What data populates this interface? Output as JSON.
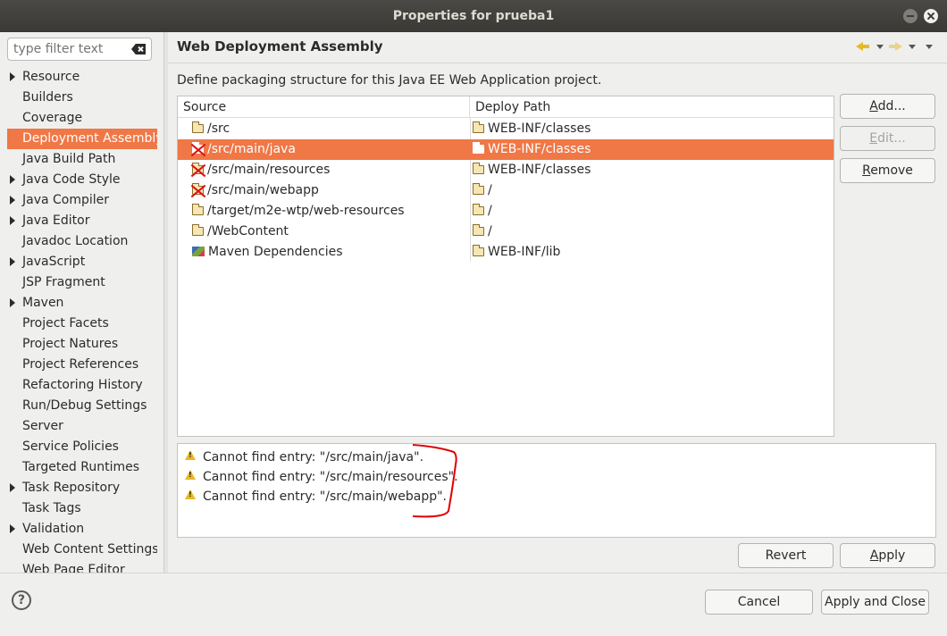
{
  "window": {
    "title": "Properties for prueba1"
  },
  "filter": {
    "placeholder": "type filter text"
  },
  "nav": {
    "items": [
      {
        "label": "Resource",
        "expandable": true
      },
      {
        "label": "Builders",
        "expandable": false
      },
      {
        "label": "Coverage",
        "expandable": false
      },
      {
        "label": "Deployment Assembly",
        "expandable": false,
        "selected": true
      },
      {
        "label": "Java Build Path",
        "expandable": false
      },
      {
        "label": "Java Code Style",
        "expandable": true
      },
      {
        "label": "Java Compiler",
        "expandable": true
      },
      {
        "label": "Java Editor",
        "expandable": true
      },
      {
        "label": "Javadoc Location",
        "expandable": false
      },
      {
        "label": "JavaScript",
        "expandable": true
      },
      {
        "label": "JSP Fragment",
        "expandable": false
      },
      {
        "label": "Maven",
        "expandable": true
      },
      {
        "label": "Project Facets",
        "expandable": false
      },
      {
        "label": "Project Natures",
        "expandable": false
      },
      {
        "label": "Project References",
        "expandable": false
      },
      {
        "label": "Refactoring History",
        "expandable": false
      },
      {
        "label": "Run/Debug Settings",
        "expandable": false
      },
      {
        "label": "Server",
        "expandable": false
      },
      {
        "label": "Service Policies",
        "expandable": false
      },
      {
        "label": "Targeted Runtimes",
        "expandable": false
      },
      {
        "label": "Task Repository",
        "expandable": true
      },
      {
        "label": "Task Tags",
        "expandable": false
      },
      {
        "label": "Validation",
        "expandable": true
      },
      {
        "label": "Web Content Settings",
        "expandable": false
      },
      {
        "label": "Web Page Editor",
        "expandable": false
      }
    ]
  },
  "page": {
    "title": "Web Deployment Assembly",
    "description": "Define packaging structure for this Java EE Web Application project."
  },
  "table": {
    "headers": {
      "source": "Source",
      "deploy": "Deploy Path"
    },
    "rows": [
      {
        "source": "/src",
        "deploy": "WEB-INF/classes",
        "error": false,
        "icon": "folder-icon",
        "selected": false
      },
      {
        "source": "/src/main/java",
        "deploy": "WEB-INF/classes",
        "error": true,
        "icon": "folder-icon",
        "selected": true
      },
      {
        "source": "/src/main/resources",
        "deploy": "WEB-INF/classes",
        "error": true,
        "icon": "folder-icon",
        "selected": false
      },
      {
        "source": "/src/main/webapp",
        "deploy": "/",
        "error": true,
        "icon": "folder-icon",
        "selected": false
      },
      {
        "source": "/target/m2e-wtp/web-resources",
        "deploy": "/",
        "error": false,
        "icon": "folder-icon",
        "selected": false
      },
      {
        "source": "/WebContent",
        "deploy": "/",
        "error": false,
        "icon": "folder-icon",
        "selected": false
      },
      {
        "source": "Maven Dependencies",
        "deploy": "WEB-INF/lib",
        "error": false,
        "icon": "maven-library-icon",
        "selected": false
      }
    ]
  },
  "side_buttons": {
    "add": {
      "label": "Add...",
      "mnemonic": "A"
    },
    "edit": {
      "label": "Edit...",
      "mnemonic": "E",
      "enabled": false
    },
    "remove": {
      "label": "Remove",
      "mnemonic": "R"
    }
  },
  "messages": [
    "Cannot find entry: \"/src/main/java\".",
    "Cannot find entry: \"/src/main/resources\".",
    "Cannot find entry: \"/src/main/webapp\"."
  ],
  "page_buttons": {
    "revert": "Revert",
    "apply": "Apply",
    "apply_mnemonic": "A"
  },
  "footer": {
    "cancel": "Cancel",
    "apply_close": "Apply and Close",
    "help": "?"
  },
  "colors": {
    "selection": "#f07746",
    "warning": "#e8b923",
    "error": "#dd1111",
    "annotation": "#e00000"
  }
}
